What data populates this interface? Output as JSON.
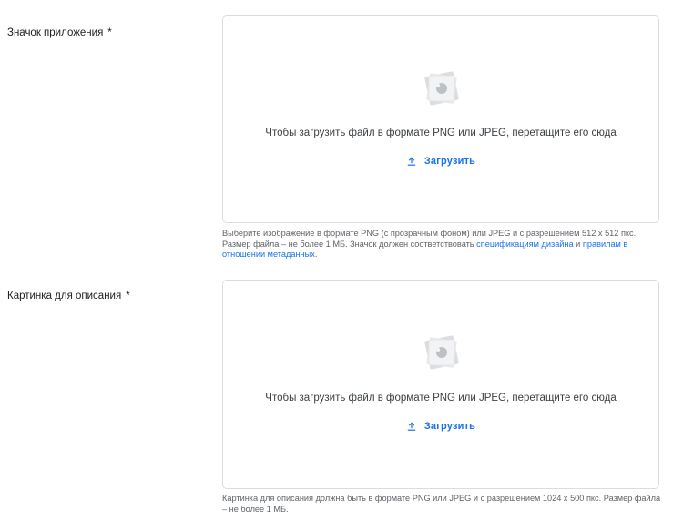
{
  "icon_field": {
    "label": "Значок приложения",
    "required_mark": "*",
    "drop_text": "Чтобы загрузить файл в формате PNG или JPEG, перетащите его сюда",
    "upload_label": "Загрузить",
    "hint_part1": "Выберите изображение в формате PNG (с прозрачным фоном) или JPEG и с разрешением 512 x 512 пкс. Размер файла – не более 1 МБ. Значок должен соответствовать ",
    "hint_link1": "спецификациям дизайна",
    "hint_part2": " и ",
    "hint_link2": "правилам в отношении метаданных",
    "hint_part3": "."
  },
  "feature_field": {
    "label": "Картинка для описания",
    "required_mark": "*",
    "drop_text": "Чтобы загрузить файл в формате PNG или JPEG, перетащите его сюда",
    "upload_label": "Загрузить",
    "hint": "Картинка для описания должна быть в формате PNG или JPEG и с разрешением 1024 x 500 пкс. Размер файла – не более 1 МБ."
  },
  "colors": {
    "link": "#1a73e8",
    "border": "#dadce0",
    "hint_text": "#5f6368"
  },
  "icons": {
    "placeholder": "image-stack-icon",
    "upload": "upload-icon"
  }
}
